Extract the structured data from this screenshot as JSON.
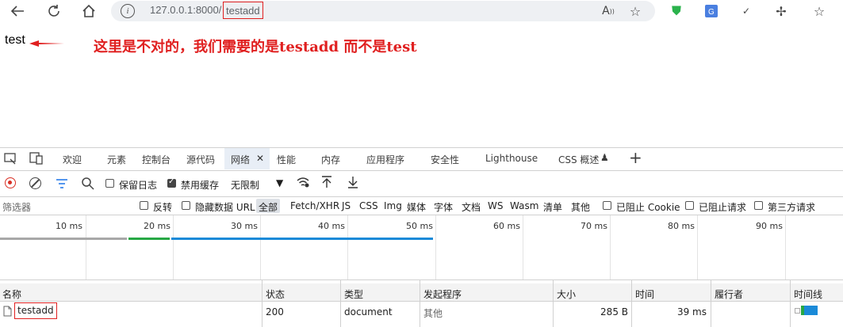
{
  "browser": {
    "url_host": "127.0.0.1:8000/",
    "url_path": "testadd",
    "icons": [
      "back-icon",
      "reload-icon",
      "home-icon",
      "info-icon",
      "read-aloud-icon",
      "favorite-icon",
      "shield-extension-icon",
      "translate-extension-icon",
      "checkmark-extension-icon",
      "extensions-icon",
      "favorites-bar-icon"
    ]
  },
  "page": {
    "text": "test",
    "annotation": "这里是不对的，我们需要的是testadd 而不是test"
  },
  "devtools": {
    "tabs": [
      "欢迎",
      "元素",
      "控制台",
      "源代码",
      "网络",
      "性能",
      "内存",
      "应用程序",
      "安全性",
      "Lighthouse",
      "CSS 概述"
    ],
    "active_tab": "网络",
    "toolbar": {
      "preserve_log": "保留日志",
      "disable_cache": "禁用缓存",
      "throttle": "无限制"
    },
    "filter": {
      "placeholder": "筛选器",
      "invert": "反转",
      "hide_data_url": "隐藏数据 URL",
      "types": [
        "全部",
        "Fetch/XHR",
        "JS",
        "CSS",
        "Img",
        "媒体",
        "字体",
        "文档",
        "WS",
        "Wasm",
        "清单",
        "其他"
      ],
      "blocked_cookie": "已阻止 Cookie",
      "blocked_requests": "已阻止请求",
      "third_party": "第三方请求"
    },
    "timeline_ticks": [
      "10 ms",
      "20 ms",
      "30 ms",
      "40 ms",
      "50 ms",
      "60 ms",
      "70 ms",
      "80 ms",
      "90 ms"
    ],
    "table": {
      "headers": [
        "名称",
        "状态",
        "类型",
        "发起程序",
        "大小",
        "时间",
        "履行者",
        "时间线"
      ],
      "rows": [
        {
          "name": "testadd",
          "status": "200",
          "type": "document",
          "initiator": "其他",
          "size": "285 B",
          "time": "39 ms",
          "fulfilled": ""
        }
      ]
    }
  }
}
